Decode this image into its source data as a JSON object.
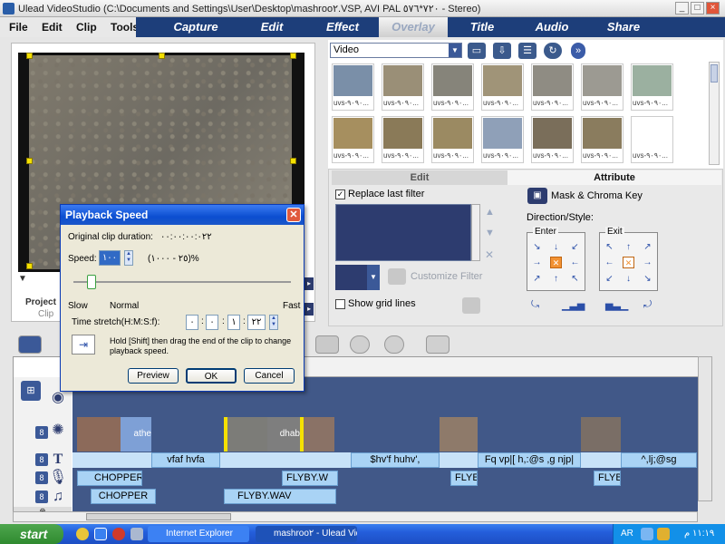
{
  "window": {
    "title": "Ulead VideoStudio (C:\\Documents and Settings\\User\\Desktop\\mashroo٢.VSP, AVI PAL ٧٢٠*٥٧٦ - Stereo)",
    "min_label": "_",
    "max_label": "□",
    "close_label": "×"
  },
  "menu": [
    "File",
    "Edit",
    "Clip",
    "Tools"
  ],
  "tabs": [
    "Capture",
    "Edit",
    "Effect",
    "Overlay",
    "Title",
    "Audio",
    "Share"
  ],
  "active_tab": "Overlay",
  "library": {
    "category": "Video",
    "thumbnail_caption": "uvs-٩٠٩٠...",
    "thumbnails": [
      {
        "caption": "uvs-٩٠٩٠...",
        "color": "#7a8fa8"
      },
      {
        "caption": "uvs-٩٠٩٠...",
        "color": "#9a8f77"
      },
      {
        "caption": "uvs-٩٠٩٠...",
        "color": "#86847a"
      },
      {
        "caption": "uvs-٩٠٩٠...",
        "color": "#a09478"
      },
      {
        "caption": "uvs-٩٠٩٠...",
        "color": "#8f8c83"
      },
      {
        "caption": "uvs-٩٠٩٠...",
        "color": "#9c9a92"
      },
      {
        "caption": "uvs-٩٠٩٠...",
        "color": "#a68f5f"
      },
      {
        "caption": "uvs-٩٠٩٠...",
        "color": "#8a7a58"
      },
      {
        "caption": "uvs-٩٠٩٠...",
        "color": "#9b8a62"
      },
      {
        "caption": "uvs-٩٠٩٠...",
        "color": "#8fa0b8"
      },
      {
        "caption": "uvs-٩٠٩٠...",
        "color": "#7a6e5a"
      },
      {
        "caption": "uvs-٩٠٩٠...",
        "color": "#8a7c5e"
      },
      {
        "caption": "uvs-٩٠٩٠...",
        "color": "#9bb0a0"
      }
    ]
  },
  "attribute_panel": {
    "tab_edit": "Edit",
    "tab_attribute": "Attribute",
    "replace_last_filter": "Replace last filter",
    "customize_filter": "Customize Filter",
    "show_grid_lines": "Show grid lines",
    "mask_chroma": "Mask & Chroma Key",
    "direction_style": "Direction/Style:",
    "enter": "Enter",
    "exit": "Exit"
  },
  "project_tabs": {
    "project": "Project",
    "clip": "Clip"
  },
  "dialog": {
    "title": "Playback Speed",
    "original_duration_label": "Original clip duration:",
    "original_duration_value": "٠٠:٠٠:٠٠:٠٢٢",
    "speed_label": "Speed:",
    "speed_value": "١٠٠",
    "speed_range": "(٢٥ - ١٠٠٠)%",
    "slow": "Slow",
    "normal": "Normal",
    "fast": "Fast",
    "time_stretch_label": "Time stretch(H:M:S:f):",
    "time_fields": [
      "٠",
      "٠",
      "١",
      "٢٢"
    ],
    "hint": "Hold [Shift] then drag the end of the clip to change playback speed.",
    "preview": "Preview",
    "ok": "OK",
    "cancel": "Cancel"
  },
  "timeline": {
    "title_clips": [
      "vfaf hvfa",
      "$hv'f huhv',",
      "Fq vp|[ h,:@s ,g njp|",
      "^,lj;@sg"
    ],
    "voice_clips": [
      "CHOPPER",
      "FLYBY.W",
      "FLYE",
      "FLYB"
    ],
    "music_clips": [
      "CHOPPER",
      "FLYBY.WAV"
    ],
    "overlay_labels": [
      "athe",
      "dhab"
    ]
  },
  "taskbar": {
    "start": "start",
    "tasks": [
      "Internet Explorer",
      "mashroo٢ - Ulead Vid..."
    ],
    "lang": "AR",
    "time": "١١:١٩ م"
  }
}
